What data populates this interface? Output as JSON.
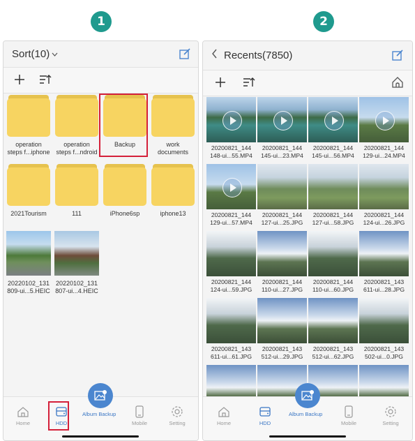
{
  "steps": [
    "1",
    "2"
  ],
  "left": {
    "title": "Sort(10)",
    "folders": [
      {
        "label": "operation\nsteps f...iphone"
      },
      {
        "label": "operation\nsteps f...ndroid"
      },
      {
        "label": "Backup"
      },
      {
        "label": "work\ndocuments"
      },
      {
        "label": "2021Tourism"
      },
      {
        "label": "111"
      },
      {
        "label": "iPhone6sp"
      },
      {
        "label": "iphone13"
      }
    ],
    "photos": [
      {
        "label": "20220102_131\n809-ui...5.HEIC"
      },
      {
        "label": "20220102_131\n807-ui...4.HEIC"
      }
    ]
  },
  "right": {
    "title": "Recents(7850)",
    "tiles": [
      {
        "label": "20200821_144\n148-ui...55.MP4",
        "video": true,
        "tone": "lake"
      },
      {
        "label": "20200821_144\n145-ui...23.MP4",
        "video": true,
        "tone": "lake"
      },
      {
        "label": "20200821_144\n145-ui...56.MP4",
        "video": true,
        "tone": "lake"
      },
      {
        "label": "20200821_144\n129-ui...24.MP4",
        "video": true,
        "tone": "sky"
      },
      {
        "label": "20200821_144\n129-ui...57.MP4",
        "video": true,
        "tone": "sky"
      },
      {
        "label": "20200821_144\n127-ui...25.JPG",
        "video": false,
        "tone": "valley"
      },
      {
        "label": "20200821_144\n127-ui...58.JPG",
        "video": false,
        "tone": "valley"
      },
      {
        "label": "20200821_144\n124-ui...26.JPG",
        "video": false,
        "tone": "valley"
      },
      {
        "label": "20200821_144\n124-ui...59.JPG",
        "video": false,
        "tone": "mountain"
      },
      {
        "label": "20200821_144\n110-ui...27.JPG",
        "video": false,
        "tone": "cloud"
      },
      {
        "label": "20200821_144\n110-ui...60.JPG",
        "video": false,
        "tone": "mountain"
      },
      {
        "label": "20200821_143\n611-ui...28.JPG",
        "video": false,
        "tone": "cloud"
      },
      {
        "label": "20200821_143\n611-ui...61.JPG",
        "video": false,
        "tone": "mountain"
      },
      {
        "label": "20200821_143\n512-ui...29.JPG",
        "video": false,
        "tone": "cloud"
      },
      {
        "label": "20200821_143\n512-ui...62.JPG",
        "video": false,
        "tone": "cloud"
      },
      {
        "label": "20200821_143\n502-ui...0.JPG",
        "video": false,
        "tone": "mountain"
      },
      {
        "label": "",
        "video": false,
        "tone": "cloud"
      },
      {
        "label": "",
        "video": false,
        "tone": "cloud"
      },
      {
        "label": "",
        "video": false,
        "tone": "cloud"
      },
      {
        "label": "",
        "video": false,
        "tone": "cloud"
      }
    ]
  },
  "nav": {
    "home": "Home",
    "hdd": "HDD",
    "album_backup": "Album Backup",
    "mobile": "Mobile",
    "setting": "Setting"
  },
  "colors": {
    "step_badge": "#1f9a8e",
    "folder": "#f7d461",
    "highlight": "#d4203a",
    "accent": "#3a76c4"
  }
}
